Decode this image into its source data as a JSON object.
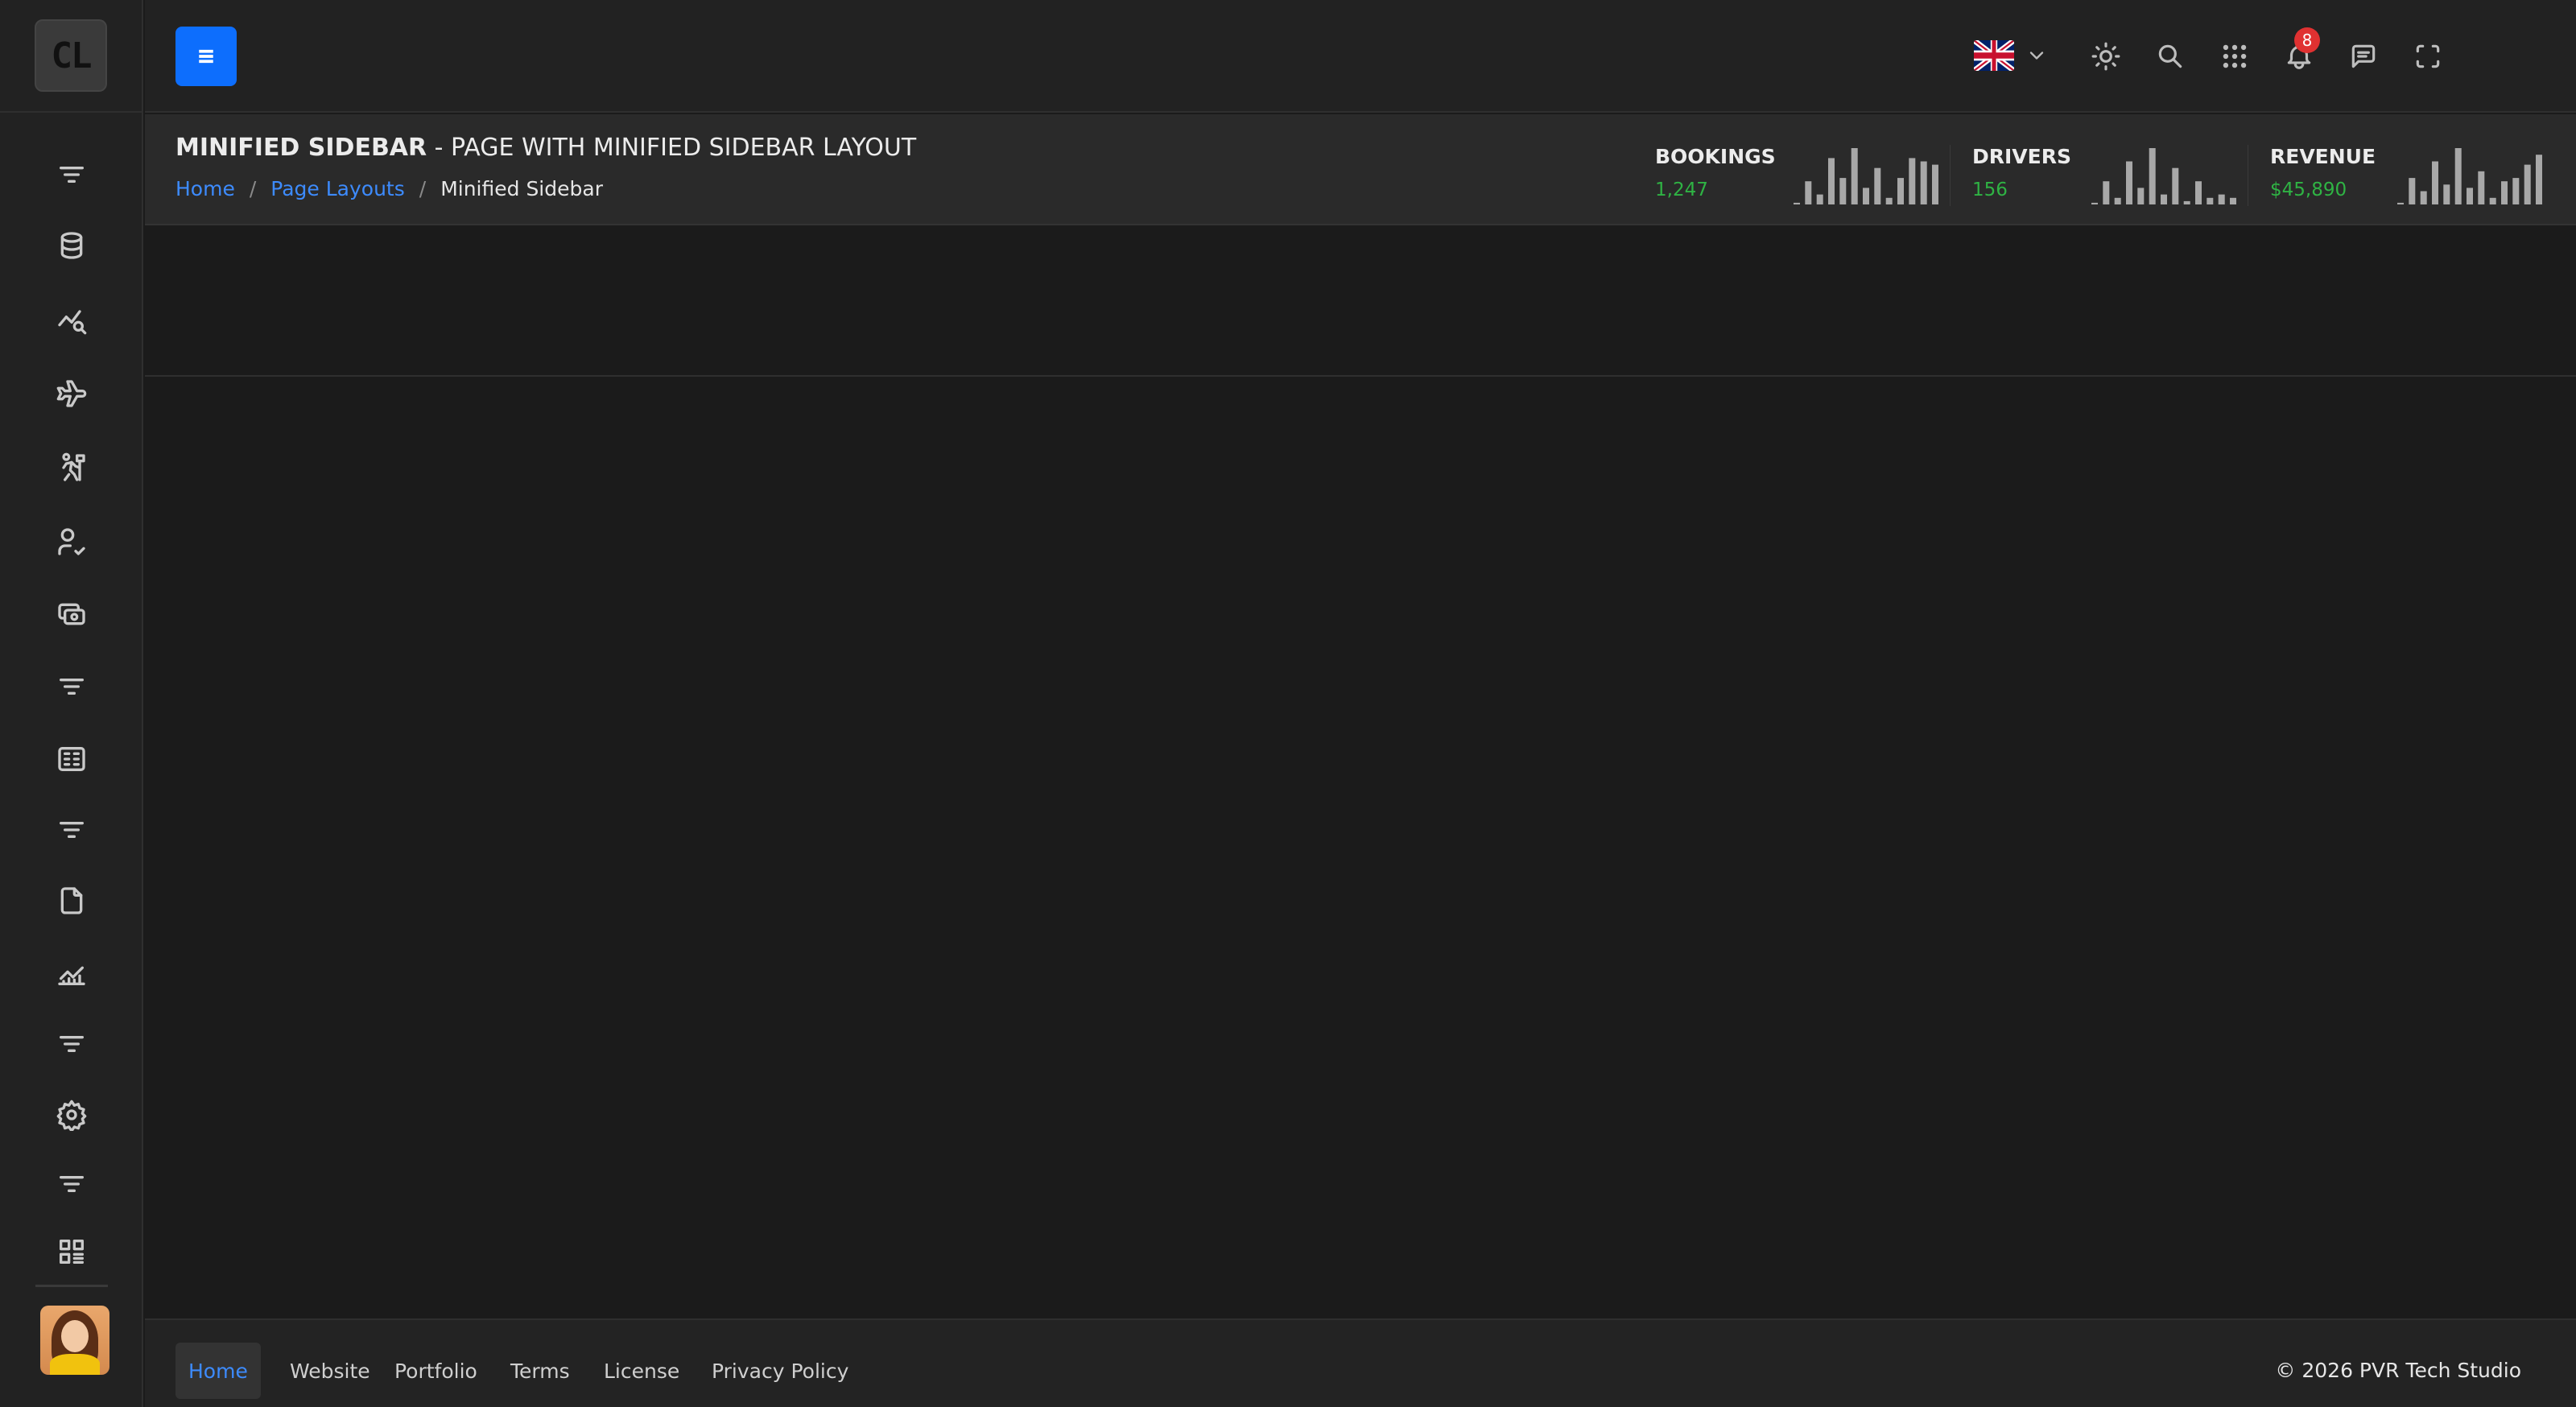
{
  "brand": {
    "logo_text": "CL"
  },
  "sidebar": {
    "icons": [
      "filter-lines-icon",
      "database-icon",
      "chart-search-icon",
      "plane-icon",
      "user-direction-icon",
      "user-check-icon",
      "cash-icon",
      "filter-lines-icon",
      "list-details-icon",
      "filter-lines-icon",
      "file-icon",
      "chart-line-icon",
      "filter-lines-icon",
      "settings-gear-icon",
      "filter-lines-icon",
      "layout-dashboard-icon"
    ]
  },
  "topbar": {
    "language": "English (UK)",
    "notification_count": "8",
    "icons": [
      "sun-icon",
      "search-icon",
      "apps-grid-icon",
      "bell-icon",
      "message-icon",
      "fullscreen-icon"
    ]
  },
  "page": {
    "title_bold": "MINIFIED SIDEBAR",
    "title_rest": " - PAGE WITH MINIFIED SIDEBAR LAYOUT",
    "breadcrumb": {
      "home": "Home",
      "parent": "Page Layouts",
      "current": "Minified Sidebar",
      "sep": "/"
    }
  },
  "stats": [
    {
      "label": "BOOKINGS",
      "value": "1,247",
      "bars": [
        1,
        14,
        6,
        28,
        16,
        34,
        10,
        22,
        4,
        16,
        28,
        26,
        24
      ]
    },
    {
      "label": "DRIVERS",
      "value": "156",
      "bars": [
        1,
        14,
        4,
        26,
        10,
        34,
        6,
        22,
        2,
        14,
        4,
        6,
        4
      ]
    },
    {
      "label": "REVENUE",
      "value": "$45,890",
      "bars": [
        1,
        16,
        8,
        26,
        12,
        34,
        10,
        20,
        4,
        14,
        16,
        24,
        30
      ]
    }
  ],
  "colors": {
    "accent": "#0d6efd",
    "positive": "#2fb344",
    "badge": "#e03131"
  },
  "footer": {
    "links": [
      "Home",
      "Website",
      "Portfolio",
      "Terms",
      "License",
      "Privacy Policy"
    ],
    "active": "Home",
    "copyright": "© 2026  PVR Tech Studio"
  }
}
